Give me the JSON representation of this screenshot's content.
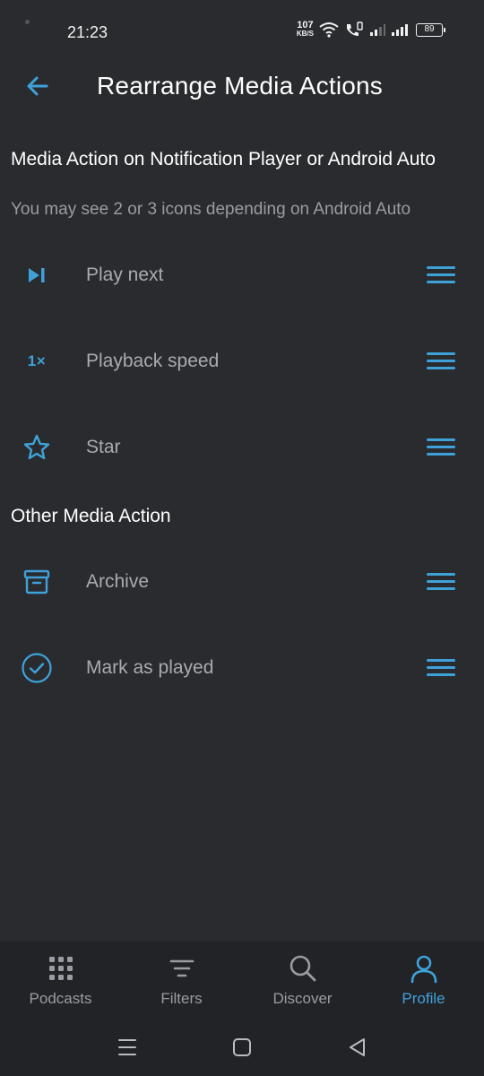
{
  "status_bar": {
    "time": "21:23",
    "net_speed_value": "107",
    "net_speed_unit": "KB/S",
    "battery": "89"
  },
  "header": {
    "title": "Rearrange Media Actions",
    "back_icon": "arrow-left-icon"
  },
  "section_notification": {
    "title": "Media Action on Notification Player or Android Auto",
    "subtitle": "You may see 2 or 3 icons depending on Android Auto",
    "items": [
      {
        "label": "Play next",
        "icon": "play-next-icon"
      },
      {
        "label": "Playback speed",
        "icon": "playback-speed-icon",
        "icon_text": "1×"
      },
      {
        "label": "Star",
        "icon": "star-icon"
      }
    ]
  },
  "section_other": {
    "title": "Other Media Action",
    "items": [
      {
        "label": "Archive",
        "icon": "archive-icon"
      },
      {
        "label": "Mark as played",
        "icon": "check-circle-icon"
      }
    ]
  },
  "bottom_nav": {
    "items": [
      {
        "label": "Podcasts",
        "icon": "grid-icon",
        "active": false
      },
      {
        "label": "Filters",
        "icon": "filter-icon",
        "active": false
      },
      {
        "label": "Discover",
        "icon": "search-icon",
        "active": false
      },
      {
        "label": "Profile",
        "icon": "person-icon",
        "active": true
      }
    ]
  },
  "colors": {
    "background": "#2a2b2f",
    "accent": "#3ea2d9",
    "nav_background": "#222327",
    "muted_text": "#9a9ca3"
  }
}
